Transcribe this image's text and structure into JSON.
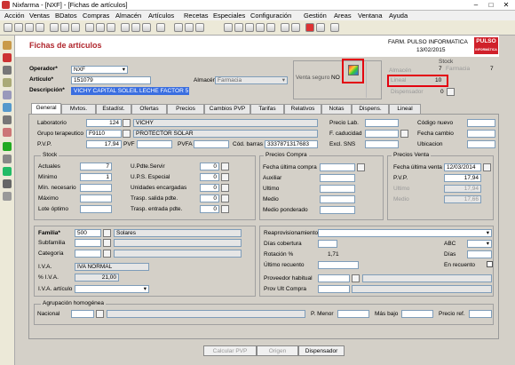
{
  "window": {
    "title": "Nixfarma - [NXF] - [Fichas de artículos]"
  },
  "menu": [
    "Acción",
    "Ventas",
    "BDatos",
    "Compras",
    "Almacén",
    "Artículos",
    "Recetas",
    "Especiales",
    "Configuración",
    "Gestión",
    "Areas",
    "Ventana",
    "Ayuda"
  ],
  "header": {
    "title": "Fichas de artículos",
    "pharmacy": "FARM. PULSO INFORMATICA",
    "date": "13/02/2015",
    "logo_text": "PULSO",
    "logo_sub": "INFORMÁTICA"
  },
  "form": {
    "operador_label": "Operador*",
    "operador": "NXF",
    "articulo_label": "Artículo*",
    "articulo": "151079",
    "descripcion_label": "Descripción*",
    "descripcion": "VICHY CAPITAL SOLEIL LECHE FACTOR 50",
    "almacen_label": "Almacén",
    "almacen": "Farmacia",
    "venta_seguro_label": "Venta seguro",
    "venta_seguro": "NO"
  },
  "stock_top": {
    "heading": "Stock",
    "almacen_label": "Almacén",
    "almacen": "7",
    "farmacia_label": "Farmacia",
    "farmacia": "7",
    "lineal_label": "Lineal",
    "lineal": "10",
    "dispensador_label": "Dispensador",
    "dispensador": "0"
  },
  "tabs": [
    "General",
    "Mvtos.",
    "Estadíst.",
    "Ofertas",
    "Precios",
    "Cambios PVP",
    "Tarifas",
    "Relativos",
    "Notas",
    "Dispens.",
    "Lineal"
  ],
  "general": {
    "laboratorio_label": "Laboratorio",
    "laboratorio_code": "124",
    "laboratorio": "VICHY",
    "grupo_label": "Grupo terapeutico",
    "grupo_code": "F9110",
    "grupo": "PROTECTOR SOLAR",
    "pvp_label": "P.V.P.",
    "pvp": "17,94",
    "pvf_label": "PVF",
    "pvfa_label": "PVFA",
    "cod_barras_label": "Cód. barras",
    "cod_barras": "3337871317683",
    "precio_lab_label": "Precio Lab.",
    "f_caducidad_label": "F. caducidad",
    "excl_sns_label": "Excl. SNS",
    "codigo_nuevo_label": "Código nuevo",
    "fecha_cambio_label": "Fecha cambio",
    "ubicacion_label": "Ubicacion"
  },
  "stock": {
    "heading": "Stock",
    "actuales_label": "Actuales",
    "actuales": "7",
    "minimo_label": "Mínimo",
    "minimo": "1",
    "min_necesario_label": "Mín. necesario",
    "maximo_label": "Máximo",
    "lote_label": "Lote óptimo",
    "u_pdte_label": "U.Pdte.Servir",
    "u_pdte": "0",
    "ups_label": "U.P.S. Especial",
    "ups": "0",
    "uds_enc_label": "Unidades encargadas",
    "uds_enc": "0",
    "trasp_salida_label": "Trasp. salida pdte.",
    "trasp_salida": "0",
    "trasp_entrada_label": "Trasp. entrada pdte.",
    "trasp_entrada": "0"
  },
  "precios_compra": {
    "heading": "Precios Compra",
    "fecha_label": "Fecha última compra",
    "auxiliar_label": "Auxiliar",
    "ultimo_label": "Ultimo",
    "medio_label": "Medio",
    "medio_pond_label": "Medio ponderado"
  },
  "precios_venta": {
    "heading": "Precios Venta",
    "fecha_label": "Fecha última venta",
    "fecha": "12/03/2014",
    "pvp_label": "P.V.P.",
    "pvp": "17,94",
    "ultimo_label": "Ultimo",
    "ultimo": "17,94",
    "medio_label": "Medio",
    "medio": "17,66"
  },
  "familia": {
    "familia_label": "Familia*",
    "familia_code": "500",
    "familia": "Solares",
    "subfamilia_label": "Subfamilia",
    "categoria_label": "Categoría",
    "iva_label": "I.V.A.",
    "iva": "IVA NORMAL",
    "piva_label": "% I.V.A.",
    "piva": "21,00",
    "iva_articulo_label": "I.V.A. artículo"
  },
  "reaprov": {
    "reaprov_label": "Reaprovisionamiento",
    "dias_cob_label": "Días cobertura",
    "abc_label": "ABC",
    "rotacion_label": "Rotación %",
    "rotacion": "1,71",
    "dias_label": "Días",
    "ultimo_recuento_label": "Último recuento",
    "en_recuento_label": "En recuento",
    "proveedor_label": "Proveedor habitual",
    "prov_ult_label": "Prov Ult Compra"
  },
  "agrupacion": {
    "heading": "Agrupación homogénea",
    "nacional_label": "Nacional",
    "p_menor_label": "P. Menor",
    "mas_bajo_label": "Más bajo",
    "precio_ref_label": "Precio ref."
  },
  "buttons": {
    "calcular": "Calcular PVP",
    "origen": "Origen",
    "dispensador": "Dispensador"
  }
}
